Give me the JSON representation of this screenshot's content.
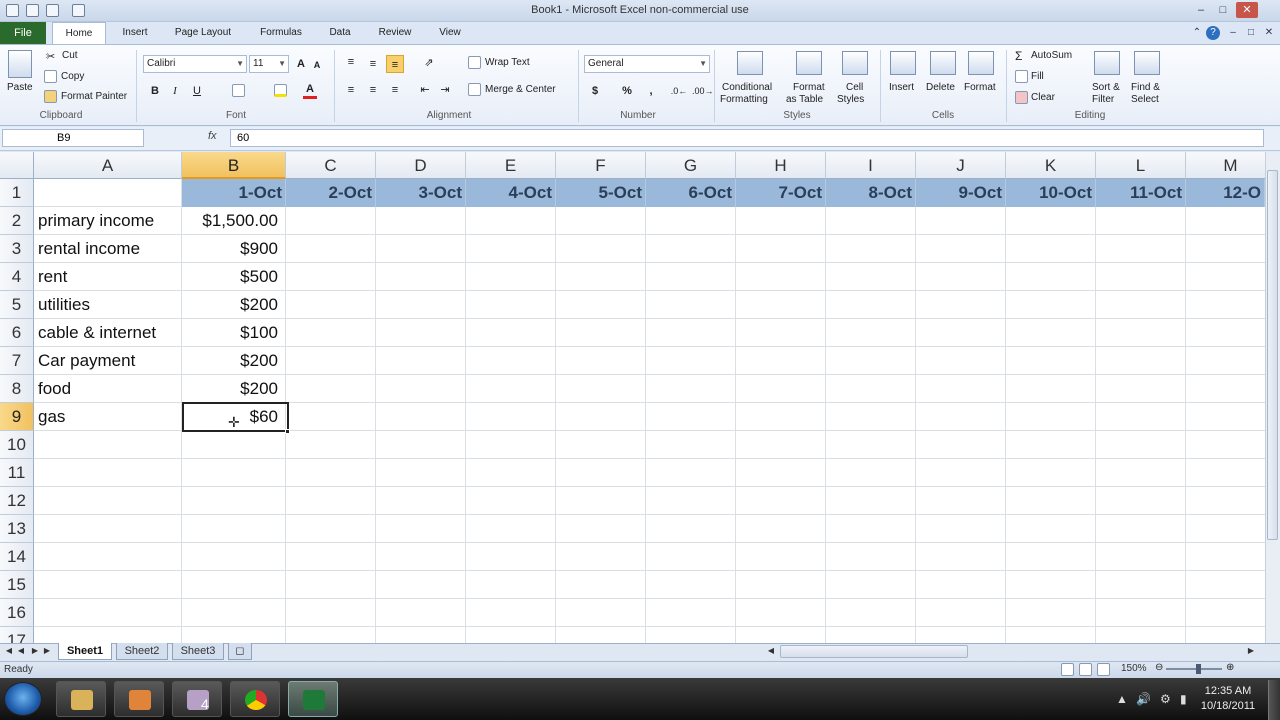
{
  "window": {
    "title": "Book1  -  Microsoft Excel non-commercial use"
  },
  "ribbon_tabs": [
    "File",
    "Home",
    "Insert",
    "Page Layout",
    "Formulas",
    "Data",
    "Review",
    "View"
  ],
  "clipboard": {
    "paste": "Paste",
    "cut": "Cut",
    "copy": "Copy",
    "format_painter": "Format Painter",
    "label": "Clipboard"
  },
  "font": {
    "name": "Calibri",
    "size": "11",
    "bold": "B",
    "italic": "I",
    "underline": "U",
    "label": "Font"
  },
  "alignment": {
    "wrap_text": "Wrap Text",
    "merge_center": "Merge & Center",
    "label": "Alignment"
  },
  "number": {
    "format": "General",
    "currency": "$",
    "percent": "%",
    "comma": ",",
    "label": "Number"
  },
  "styles": {
    "conditional_formatting_1": "Conditional",
    "conditional_formatting_2": "Formatting",
    "format_table_1": "Format",
    "format_table_2": "as Table",
    "cell_styles_1": "Cell",
    "cell_styles_2": "Styles",
    "label": "Styles"
  },
  "cells_group": {
    "insert": "Insert",
    "delete": "Delete",
    "format": "Format",
    "label": "Cells"
  },
  "editing": {
    "autosum": "AutoSum",
    "fill": "Fill",
    "clear": "Clear",
    "sort_filter_1": "Sort &",
    "sort_filter_2": "Filter",
    "find_select_1": "Find &",
    "find_select_2": "Select",
    "label": "Editing"
  },
  "formula_bar": {
    "name_box": "B9",
    "fx": "fx",
    "content": "60"
  },
  "sheet": {
    "columns": [
      "A",
      "B",
      "C",
      "D",
      "E",
      "F",
      "G",
      "H",
      "I",
      "J",
      "K",
      "L",
      "M"
    ],
    "rows": [
      "1",
      "2",
      "3",
      "4",
      "5",
      "6",
      "7",
      "8",
      "9",
      "10",
      "11",
      "12",
      "13",
      "14",
      "15",
      "16",
      "17"
    ],
    "dates": [
      "1-Oct",
      "2-Oct",
      "3-Oct",
      "4-Oct",
      "5-Oct",
      "6-Oct",
      "7-Oct",
      "8-Oct",
      "9-Oct",
      "10-Oct",
      "11-Oct",
      "12-O"
    ],
    "items": [
      {
        "label": "primary income",
        "value": "$1,500.00"
      },
      {
        "label": "rental income",
        "value": "$900"
      },
      {
        "label": "rent",
        "value": "$500"
      },
      {
        "label": "utilities",
        "value": "$200"
      },
      {
        "label": "cable & internet",
        "value": "$100"
      },
      {
        "label": "Car payment",
        "value": "$200"
      },
      {
        "label": "food",
        "value": "$200"
      },
      {
        "label": "gas",
        "value": "$60"
      }
    ],
    "selected_cell": "B9",
    "header_fill_color": "#9ab8d9",
    "selection_color": "#f1c15f"
  },
  "sheet_tabs": [
    "Sheet1",
    "Sheet2",
    "Sheet3"
  ],
  "status": {
    "text": "Ready",
    "zoom": "150%"
  },
  "taskbar": {
    "time": "12:35 AM",
    "date": "10/18/2011",
    "badge": "4"
  }
}
